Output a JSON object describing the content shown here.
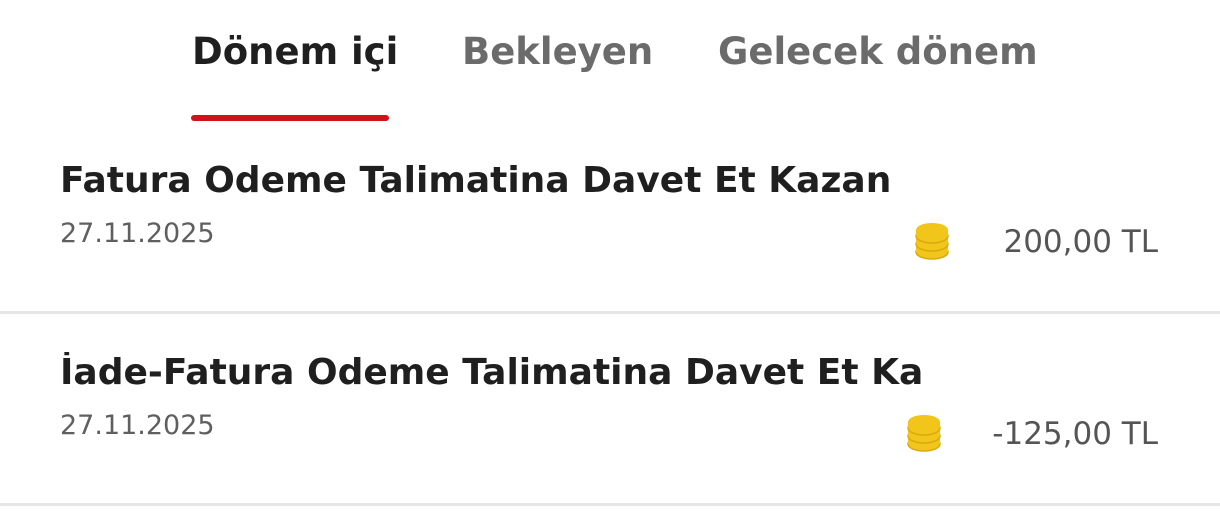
{
  "tabs": [
    {
      "label": "Dönem içi",
      "active": true
    },
    {
      "label": "Bekleyen",
      "active": false
    },
    {
      "label": "Gelecek dönem",
      "active": false
    }
  ],
  "colors": {
    "accent": "#d0121b",
    "coin": "#f2c51b",
    "coin_dark": "#d9a90f"
  },
  "transactions": [
    {
      "title": "Fatura Odeme Talimatina Davet Et Kazan",
      "date": "27.11.2025",
      "amount": "200,00 TL",
      "icon": "coin-stack-icon"
    },
    {
      "title": "İade-Fatura Odeme Talimatina Davet Et Ka",
      "date": "27.11.2025",
      "amount": "-125,00 TL",
      "icon": "coin-stack-icon"
    }
  ]
}
